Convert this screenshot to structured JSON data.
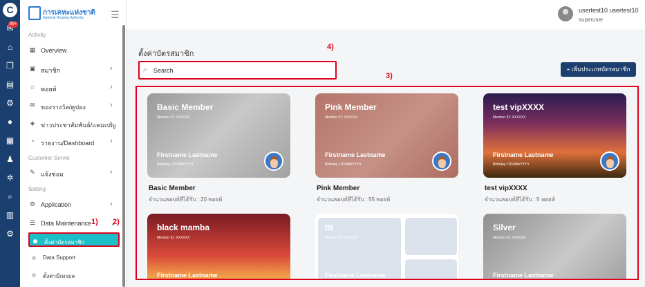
{
  "sidebar": {
    "brand_th": "การเคหะแห่งชาติ",
    "brand_en": "National Housing Authority",
    "rail_badge": "99+",
    "sections": {
      "activity": "Activity",
      "customer": "Customer Servie",
      "setting": "Setting"
    },
    "items": [
      {
        "label": "Overview",
        "icon": "grid-icon"
      },
      {
        "label": "สมาชิก",
        "icon": "member-icon"
      },
      {
        "label": "พอยท์",
        "icon": "star-icon"
      },
      {
        "label": "ของรางวัล/คูปอง",
        "icon": "gift-icon"
      },
      {
        "label": "ข่าวประชาสัมพันธ์/แคมเปญ",
        "icon": "news-icon"
      },
      {
        "label": "รายงาน/Dashboard",
        "icon": "report-icon"
      },
      {
        "label": "แจ้งซ่อม",
        "icon": "wrench-icon"
      },
      {
        "label": "Application",
        "icon": "gear-icon"
      },
      {
        "label": "Data Maintenance",
        "icon": "sliders-icon"
      }
    ],
    "subitems": [
      {
        "label": "ตั้งค่าบัตรสมาชิก"
      },
      {
        "label": "Data Support"
      },
      {
        "label": "ตั้งค่ามีเหรยล"
      }
    ]
  },
  "topbar": {
    "username": "usertest10 usertest10",
    "role": "superuser"
  },
  "main": {
    "title": "ตั้งค่าบัตรสมาชิก",
    "search_placeholder": "Search",
    "add_button": "+ เพิ่มประเภทบัตรสมาชิก"
  },
  "annotations": {
    "a1": "1)",
    "a2": "2)",
    "a3": "3)",
    "a4": "4)"
  },
  "cards": [
    {
      "title": "Basic Member",
      "member_id": "Member ID: XXXXXX",
      "name": "Firstname Lastname",
      "birthday": "Birthday: DD/MM/YYYY",
      "label": "Basic Member",
      "points": "จำนวนพอยท์ที่ได้รับ : 20 พอยท์"
    },
    {
      "title": "Pink Member",
      "member_id": "Member ID: XXXXXX",
      "name": "Firstname Lastname",
      "birthday": "Birthday: DD/MM/YYYY",
      "label": "Pink Member",
      "points": "จำนวนพอยท์ที่ได้รับ : 55 พอยท์"
    },
    {
      "title": "test vipXXXX",
      "member_id": "Member ID: XXXXXX",
      "name": "Firstname Lastname",
      "birthday": "Birthday: DD/MM/YYYY",
      "label": "test vipXXXX",
      "points": "จำนวนพอยท์ที่ได้รับ : 5 พอยท์"
    },
    {
      "title": "black mamba",
      "member_id": "Member ID: XXXXXX",
      "name": "Firstname Lastname"
    },
    {
      "title": "ttt",
      "member_id": "Member ID: XXXXXX",
      "name": "Firstname Lastname"
    },
    {
      "title": "Silver",
      "member_id": "Member ID: XXXXXX",
      "name": "Firstname Lastname"
    }
  ]
}
